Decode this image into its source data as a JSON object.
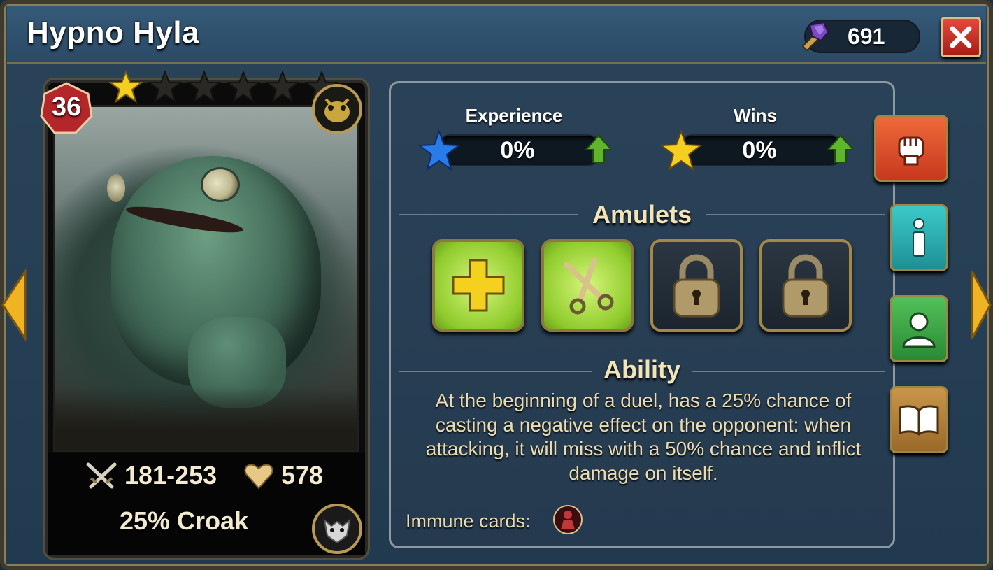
{
  "header": {
    "title": "Hypno Hyla",
    "currency_value": "691",
    "currency_icon": "purple-hammer-icon",
    "close_icon": "close-icon"
  },
  "card": {
    "level": "36",
    "stars_filled": 1,
    "stars_total": 6,
    "attack": "181-253",
    "health": "578",
    "ability_short": "25% Croak",
    "faction_icon": "toad-faction-icon",
    "class_icon": "beast-skull-icon"
  },
  "stats": {
    "experience_label": "Experience",
    "experience_value": "0%",
    "wins_label": "Wins",
    "wins_value": "0%"
  },
  "amulets": {
    "title": "Amulets",
    "slots": [
      {
        "state": "active",
        "icon": "plus-icon"
      },
      {
        "state": "active",
        "icon": "scissors-icon"
      },
      {
        "state": "locked",
        "icon": "padlock-icon"
      },
      {
        "state": "locked",
        "icon": "padlock-icon"
      }
    ]
  },
  "ability": {
    "title": "Ability",
    "description": "At the beginning of a duel, has a 25% chance of casting a negative effect on the opponent: when attacking, it will miss with a 50% chance and inflict damage on itself.",
    "immune_label": "Immune cards:"
  },
  "side_tabs": [
    {
      "name": "fight",
      "icon": "fist-icon",
      "color": "#e8532f"
    },
    {
      "name": "info",
      "icon": "info-icon",
      "color": "#2ab6b8"
    },
    {
      "name": "upgrade",
      "icon": "character-icon",
      "color": "#3aa34a"
    },
    {
      "name": "lore",
      "icon": "book-icon",
      "color": "#b8823a"
    }
  ]
}
